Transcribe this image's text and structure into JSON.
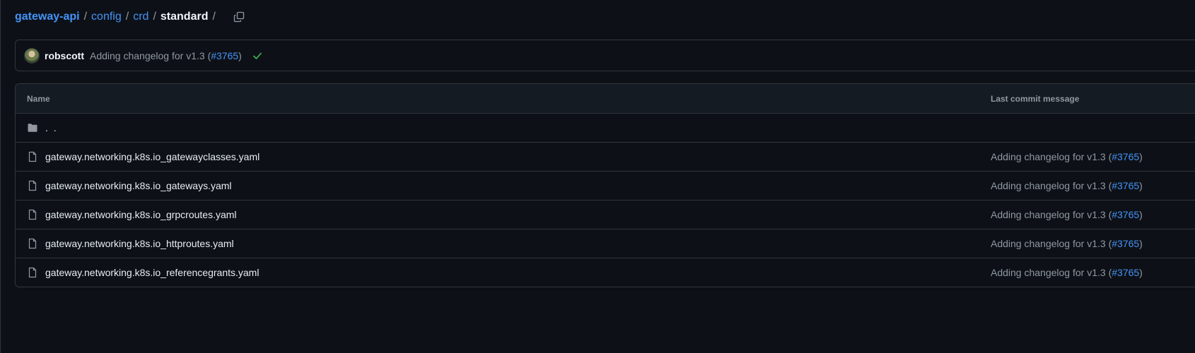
{
  "breadcrumb": {
    "root": "gateway-api",
    "segments": [
      "config",
      "crd"
    ],
    "current": "standard",
    "separator": "/"
  },
  "commit": {
    "author": "robscott",
    "message_prefix": "Adding changelog for v1.3 (",
    "pr": "#3765",
    "message_suffix": ")",
    "status": "success"
  },
  "table": {
    "headers": {
      "name": "Name",
      "last_commit": "Last commit message"
    },
    "parent_label": ". .",
    "files": [
      {
        "name": "gateway.networking.k8s.io_gatewayclasses.yaml",
        "msg_prefix": "Adding changelog for v1.3 (",
        "pr": "#3765",
        "msg_suffix": ")"
      },
      {
        "name": "gateway.networking.k8s.io_gateways.yaml",
        "msg_prefix": "Adding changelog for v1.3 (",
        "pr": "#3765",
        "msg_suffix": ")"
      },
      {
        "name": "gateway.networking.k8s.io_grpcroutes.yaml",
        "msg_prefix": "Adding changelog for v1.3 (",
        "pr": "#3765",
        "msg_suffix": ")"
      },
      {
        "name": "gateway.networking.k8s.io_httproutes.yaml",
        "msg_prefix": "Adding changelog for v1.3 (",
        "pr": "#3765",
        "msg_suffix": ")"
      },
      {
        "name": "gateway.networking.k8s.io_referencegrants.yaml",
        "msg_prefix": "Adding changelog for v1.3 (",
        "pr": "#3765",
        "msg_suffix": ")"
      }
    ]
  },
  "colors": {
    "background": "#0d1117",
    "link": "#4493f8",
    "muted": "#9198a1",
    "border": "#30363d",
    "success": "#3fb950"
  },
  "icons": {
    "copy": "copy-icon",
    "check": "check-icon",
    "folder": "folder-icon",
    "file": "file-icon"
  }
}
